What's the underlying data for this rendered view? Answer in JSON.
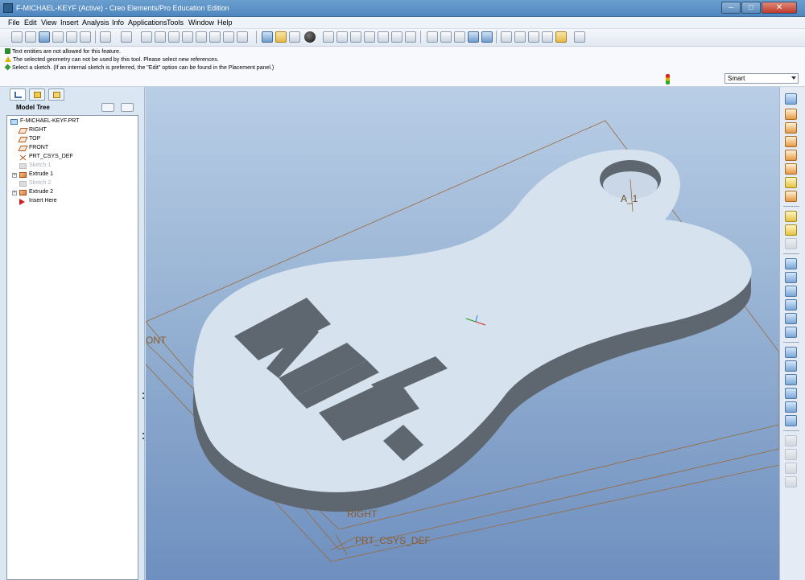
{
  "window": {
    "title": "F-MICHAEL-KEYF (Active) - Creo Elements/Pro Education Edition",
    "min_glyph": "–",
    "max_glyph": "□",
    "close_glyph": "✕"
  },
  "menu": [
    "File",
    "Edit",
    "View",
    "Insert",
    "Analysis",
    "Info",
    "Applications",
    "Tools",
    "Window",
    "Help"
  ],
  "messages": [
    {
      "type": "ok",
      "text": "Text entities are not allowed for this feature."
    },
    {
      "type": "warn",
      "text": "The selected geometry can not be used by this tool. Please select new references."
    },
    {
      "type": "prompt",
      "text": "Select a sketch. (If an internal sketch is preferred, the \"Edit\" option can be found in the Placement panel.)"
    }
  ],
  "filter": {
    "value": "Smart"
  },
  "navigator": {
    "header_label": "Model Tree",
    "items": [
      {
        "label": "F-MICHAEL-KEYF.PRT",
        "icon": "part-icon",
        "dim": false,
        "expand": ""
      },
      {
        "label": "RIGHT",
        "icon": "datum-plane-icon",
        "dim": false,
        "expand": ""
      },
      {
        "label": "TOP",
        "icon": "datum-plane-icon",
        "dim": false,
        "expand": ""
      },
      {
        "label": "FRONT",
        "icon": "datum-plane-icon",
        "dim": false,
        "expand": ""
      },
      {
        "label": "PRT_CSYS_DEF",
        "icon": "csys-icon",
        "dim": false,
        "expand": ""
      },
      {
        "label": "Sketch 1",
        "icon": "sketch-icon",
        "dim": true,
        "expand": ""
      },
      {
        "label": "Extrude 1",
        "icon": "extrude-icon",
        "dim": false,
        "expand": "+"
      },
      {
        "label": "Sketch 2",
        "icon": "sketch-icon",
        "dim": true,
        "expand": ""
      },
      {
        "label": "Extrude 2",
        "icon": "extrude-icon",
        "dim": false,
        "expand": "+"
      },
      {
        "label": "Insert Here",
        "icon": "insert-here-arrow-icon",
        "dim": false,
        "expand": ""
      }
    ]
  },
  "graphics": {
    "labels": {
      "axis": "A_1",
      "front": "ONT",
      "right": "RIGHT",
      "csys": "PRT_CSYS_DEF"
    },
    "colors": {
      "background_top": "#b9cee6",
      "background_bottom": "#6e8fbf",
      "part_top": "#d6e2ee",
      "part_side": "#5e6770",
      "datum": "#9a6a3a"
    }
  }
}
